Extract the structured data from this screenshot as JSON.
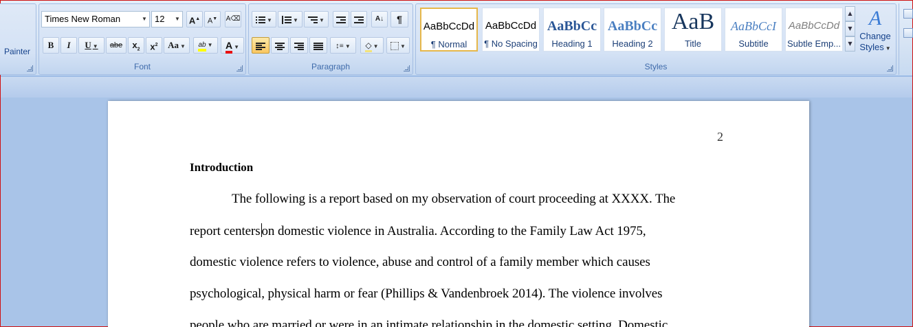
{
  "clipboard": {
    "painter_label": "Painter"
  },
  "font_group": {
    "label": "Font",
    "font_name": "Times New Roman",
    "font_size": "12",
    "grow_font": "A",
    "shrink_font": "A",
    "bold": "B",
    "italic": "I",
    "underline": "U",
    "strikethrough": "abe",
    "subscript": "x",
    "superscript": "x",
    "change_case": "Aa",
    "highlight": "ab",
    "font_color": "A"
  },
  "paragraph_group": {
    "label": "Paragraph",
    "pilcrow": "¶"
  },
  "styles_group": {
    "label": "Styles",
    "tiles": [
      {
        "sample": "AaBbCcDd",
        "name": "¶ Normal"
      },
      {
        "sample": "AaBbCcDd",
        "name": "¶ No Spacing"
      },
      {
        "sample": "AaBbCc",
        "name": "Heading 1"
      },
      {
        "sample": "AaBbCc",
        "name": "Heading 2"
      },
      {
        "sample": "AaB",
        "name": "Title"
      },
      {
        "sample": "AaBbCcI",
        "name": "Subtitle"
      },
      {
        "sample": "AaBbCcDd",
        "name": "Subtle Emp..."
      }
    ],
    "change_styles_line1": "Change",
    "change_styles_line2": "Styles"
  },
  "document": {
    "page_number": "2",
    "heading": "Introduction",
    "line1": "The following is a report based on my observation of court proceeding at XXXX. The",
    "line2_before_caret": "report centers",
    "line2_after_caret": "on domestic violence in Australia. According to the Family Law Act 1975,",
    "line3": "domestic violence refers to violence, abuse and control of a family member which causes",
    "line4": "psychological, physical harm or fear (Phillips & Vandenbroek 2014).  The violence involves",
    "line5": "people who are married or were in an intimate relationship in the domestic setting.  Domestic"
  },
  "colors": {
    "highlight": "#ffff00",
    "font_color": "#e81010",
    "selected_style_border": "#e6b74a",
    "window_border": "#d01010"
  }
}
